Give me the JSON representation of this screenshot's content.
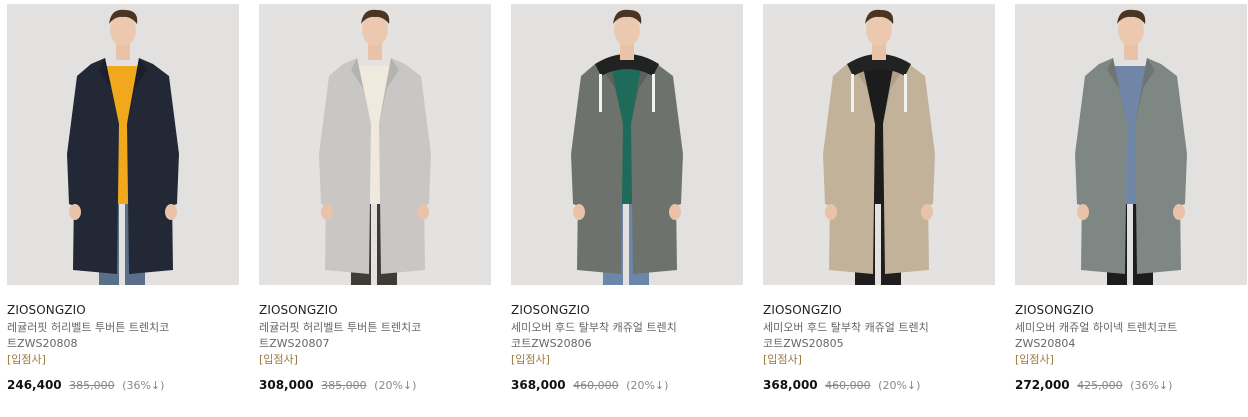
{
  "products": [
    {
      "brand": "ZIOSONGZIO",
      "name": "레귤러핏 허리벨트 투버튼 트렌치코트ZWS20808",
      "badge": "[입점사]",
      "price": "246,400",
      "original_price": "385,000",
      "discount": "(36%↓)",
      "colors": {
        "bg": "#e2e1df",
        "coat": "#232836",
        "inner": "#f2a81c",
        "pants": "#5a6f8a",
        "lapel": "#1b1f2b"
      }
    },
    {
      "brand": "ZIOSONGZIO",
      "name": "레귤러핏 허리벨트 투버튼 트렌치코트ZWS20807",
      "badge": "[입점사]",
      "price": "308,000",
      "original_price": "385,000",
      "discount": "(20%↓)",
      "colors": {
        "bg": "#e3e2e0",
        "coat": "#c9c7c6",
        "inner": "#efe9de",
        "pants": "#3f3b35",
        "lapel": "#b5b3b2"
      }
    },
    {
      "brand": "ZIOSONGZIO",
      "name": "세미오버 후드 탈부착 캐쥬얼 트렌치코트ZWS20806",
      "badge": "[입점사]",
      "price": "368,000",
      "original_price": "460,000",
      "discount": "(20%↓)",
      "colors": {
        "bg": "#e2e1df",
        "coat": "#6d736c",
        "inner": "#1f6b5a",
        "pants": "#6a86a8",
        "lapel": "#5c625b"
      }
    },
    {
      "brand": "ZIOSONGZIO",
      "name": "세미오버 후드 탈부착 캐쥬얼 트렌치코트ZWS20805",
      "badge": "[입점사]",
      "price": "368,000",
      "original_price": "460,000",
      "discount": "(20%↓)",
      "colors": {
        "bg": "#e3e2e0",
        "coat": "#c2b29a",
        "inner": "#1c1c1c",
        "pants": "#1e1e1e",
        "lapel": "#b0a087"
      }
    },
    {
      "brand": "ZIOSONGZIO",
      "name": "세미오버 캐쥬얼 하이넥 트렌치코트ZWS20804",
      "badge": "[입점사]",
      "price": "272,000",
      "original_price": "425,000",
      "discount": "(36%↓)",
      "colors": {
        "bg": "#e2e1df",
        "coat": "#7f8785",
        "inner": "#6f86a6",
        "pants": "#1c1c1c",
        "lapel": "#6e7674"
      }
    }
  ]
}
